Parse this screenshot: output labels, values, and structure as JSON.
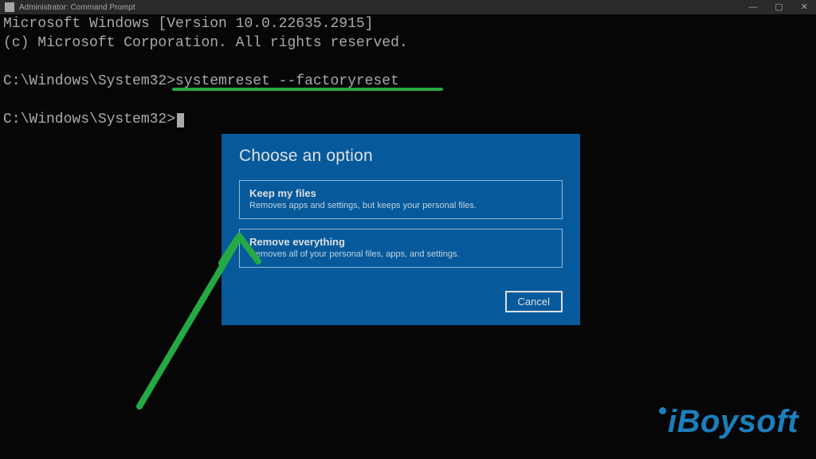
{
  "titlebar": {
    "title": "Administrator: Command Prompt"
  },
  "terminal": {
    "line1": "Microsoft Windows [Version 10.0.22635.2915]",
    "line2": "(c) Microsoft Corporation. All rights reserved.",
    "prompt_path": "C:\\Windows\\System32>",
    "command": "systemreset --factoryreset"
  },
  "modal": {
    "title": "Choose an option",
    "options": [
      {
        "title": "Keep my files",
        "desc": "Removes apps and settings, but keeps your personal files."
      },
      {
        "title": "Remove everything",
        "desc": "Removes all of your personal files, apps, and settings."
      }
    ],
    "cancel_label": "Cancel"
  },
  "watermark": {
    "text": "iBoysoft"
  },
  "annotations": {
    "underline_target": "systemreset --factoryreset",
    "arrow_target": "Remove everything"
  },
  "colors": {
    "modal_bg": "#0063b1",
    "accent_green": "#24c04a",
    "watermark_blue": "#1a8fd8",
    "terminal_fg": "#c0c0c0"
  }
}
